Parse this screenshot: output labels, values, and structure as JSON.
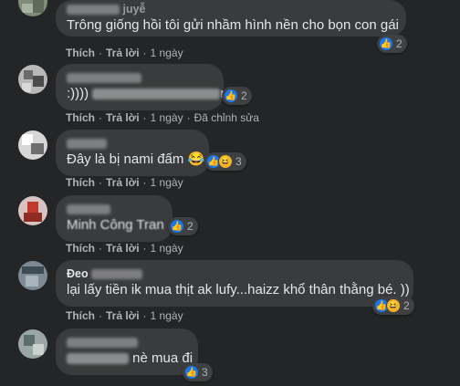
{
  "comments": [
    {
      "text": "Trông giống hồi tôi gửi nhầm hình nền cho bọn con gái",
      "name_hint": "juyễ",
      "reactions": [
        "like"
      ],
      "reaction_count": "2",
      "actions": {
        "like": "Thích",
        "reply": "Trả lời",
        "time": "1 ngày",
        "edited": ""
      }
    },
    {
      "text_prefix": ":))))",
      "text_suffix": "n",
      "name_hint": "",
      "reactions": [
        "like"
      ],
      "reaction_count": "2",
      "actions": {
        "like": "Thích",
        "reply": "Trả lời",
        "time": "1 ngày",
        "edited": "Đã chỉnh sửa"
      }
    },
    {
      "text": "Đây là bị nami đấm 😂",
      "name_hint": "",
      "reactions": [
        "like",
        "haha"
      ],
      "reaction_count": "3",
      "actions": {
        "like": "Thích",
        "reply": "Trả lời",
        "time": "1 ngày",
        "edited": ""
      }
    },
    {
      "text": "Minh Công Tran",
      "name_hint": "",
      "reactions": [
        "like"
      ],
      "reaction_count": "2",
      "actions": {
        "like": "Thích",
        "reply": "Trả lời",
        "time": "1 ngày",
        "edited": ""
      }
    },
    {
      "text": "lại lấy tiền ik mua thịt ak lufy...haizz khổ thân thằng bé. ))",
      "name_hint": "Đeo",
      "reactions": [
        "like",
        "haha"
      ],
      "reaction_count": "2",
      "actions": {
        "like": "Thích",
        "reply": "Trả lời",
        "time": "1 ngày",
        "edited": ""
      }
    },
    {
      "text": "nè mua đi",
      "name_hint": "",
      "reactions": [
        "like"
      ],
      "reaction_count": "3",
      "actions": {
        "like": "Thích",
        "reply": "Trả lời",
        "time": "1 ngày",
        "edited": ""
      }
    }
  ],
  "colors": {
    "background": "#242526",
    "bubble": "#3a3b3c",
    "secondary_text": "#b0b3b8",
    "like_blue": "#1877f2",
    "haha_yellow": "#f7b125"
  }
}
